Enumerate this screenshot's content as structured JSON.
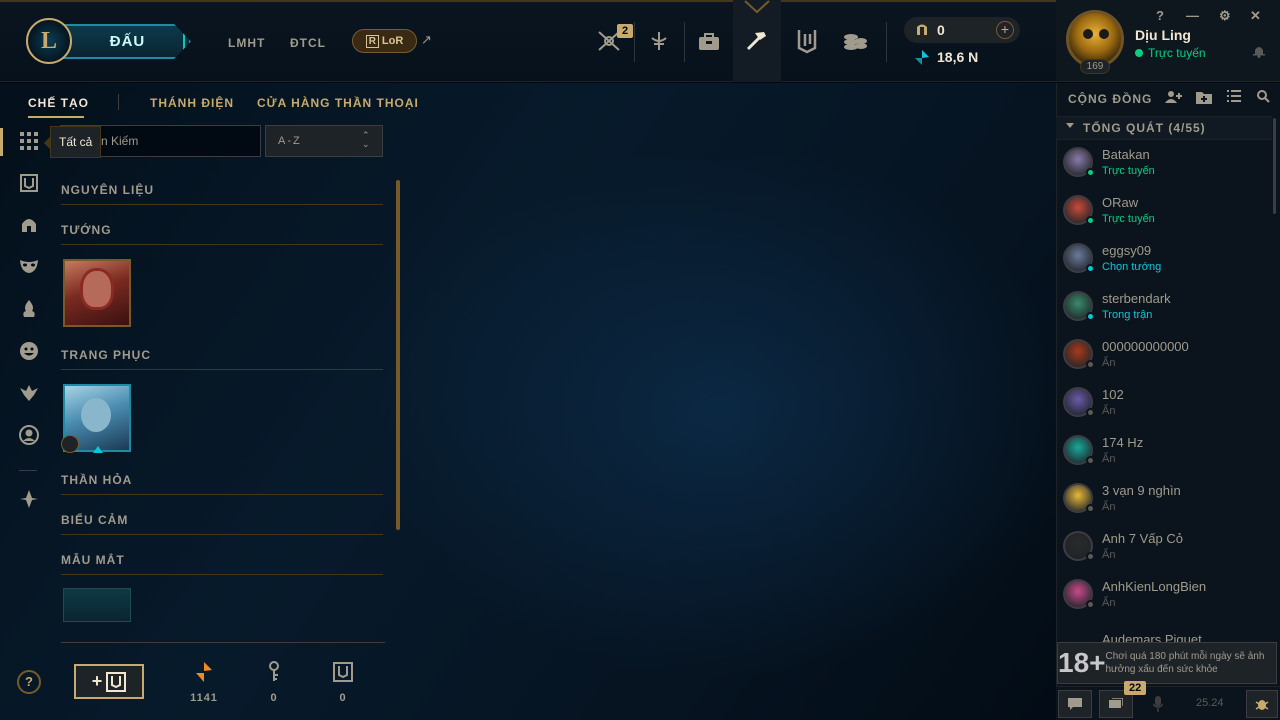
{
  "topbar": {
    "logo_letter": "L",
    "play_label": "ĐẤU",
    "nav": [
      "LMHT",
      "ĐTCL"
    ],
    "lor": "LoR",
    "lor_icon": "R",
    "notification_count": "2",
    "currency": {
      "rp": "0",
      "blue_essence": "18,6 N",
      "plus": "+"
    },
    "icons": [
      "clash-icon",
      "ranked-icon",
      "store-bag-icon",
      "crafting-hammer-icon",
      "collection-icon",
      "loot-coins-icon"
    ]
  },
  "profile": {
    "name": "Dịu Ling",
    "status": "Trực tuyến",
    "level": "169",
    "controls": [
      "?",
      "—",
      "⚙",
      "✕"
    ]
  },
  "subnav": {
    "items": [
      "CHẾ TẠO",
      "THÁNH ĐIỆN",
      "CỬA HÀNG THẦN THOẠI"
    ],
    "active_index": 0
  },
  "filters": {
    "tooltip": "Tất cả",
    "search_text": "n Kiếm",
    "sort": "A-Z"
  },
  "inventory": {
    "sections": [
      "NGUYÊN LIỆU",
      "TƯỚNG",
      "TRANG PHỤC",
      "THẦN HỎA",
      "BIỂU CẢM",
      "MẪU MẮT"
    ]
  },
  "bottom": {
    "help": "?",
    "add_label": "+",
    "currencies": [
      {
        "icon": "orange-essence-icon",
        "value": "1141"
      },
      {
        "icon": "key-icon",
        "value": "0"
      },
      {
        "icon": "chest-icon",
        "value": "0"
      }
    ]
  },
  "social": {
    "title": "CỘNG ĐỒNG",
    "group_label": "TỔNG QUÁT (4/55)",
    "friends": [
      {
        "name": "Batakan",
        "status": "Trực tuyến",
        "color": "#0acf83",
        "av": "#8a7aa8"
      },
      {
        "name": "ORaw",
        "status": "Trực tuyến",
        "color": "#0acf83",
        "av": "#c84a3a"
      },
      {
        "name": "eggsy09",
        "status": "Chọn tướng",
        "color": "#0ac8d9",
        "av": "#6a7a9a"
      },
      {
        "name": "sterbendark",
        "status": "Trong trận",
        "color": "#0ac8d9",
        "av": "#3a8a6a"
      },
      {
        "name": "000000000000",
        "status": "Ẩn",
        "color": "#5b5a56",
        "av": "#a83a1a"
      },
      {
        "name": "102",
        "status": "Ẩn",
        "color": "#5b5a56",
        "av": "#6a5aa8"
      },
      {
        "name": "174 Hz",
        "status": "Ẩn",
        "color": "#5b5a56",
        "av": "#1aa89a"
      },
      {
        "name": "3 vạn 9 nghìn",
        "status": "Ẩn",
        "color": "#5b5a56",
        "av": "#e8b83a"
      },
      {
        "name": "Anh 7 Vấp Cỏ",
        "status": "Ẩn",
        "color": "#5b5a56",
        "av": "#2a2a2a"
      },
      {
        "name": "AnhKienLongBien",
        "status": "Ẩn",
        "color": "#5b5a56",
        "av": "#c84a8a"
      }
    ],
    "partial_friend": "Audemars Piguet",
    "warning_age": "18+",
    "warning_text": "Chơi quá 180 phút mỗi ngày sẽ ảnh hưởng xấu đến sức khỏe",
    "chat_count": "22",
    "version": "25.24"
  }
}
